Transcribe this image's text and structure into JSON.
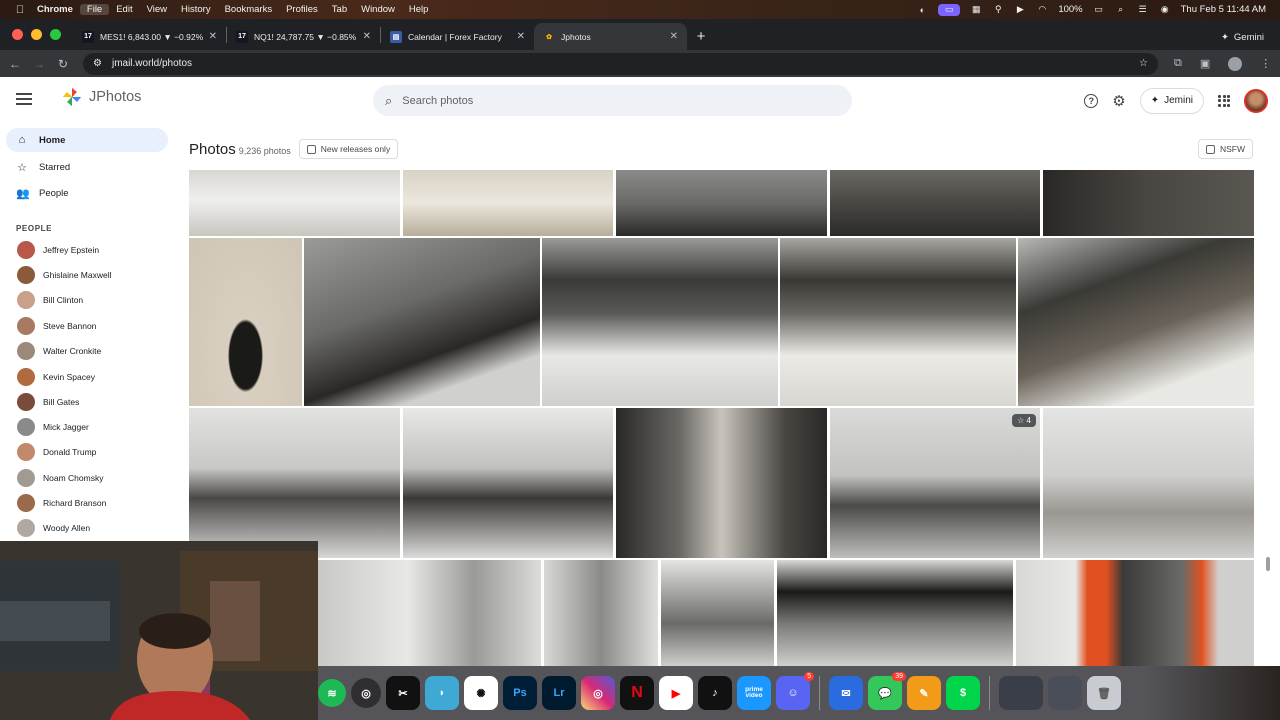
{
  "menubar": {
    "app": "Chrome",
    "items": [
      "File",
      "Edit",
      "View",
      "History",
      "Bookmarks",
      "Profiles",
      "Tab",
      "Window",
      "Help"
    ],
    "battery": "100%",
    "datetime": "Thu Feb 5  11:44 AM"
  },
  "tabs": [
    {
      "title": "MES1! 6,843.00 ▼ −0.92% G",
      "favicon": "tradingview-icon"
    },
    {
      "title": "NQ1! 24,787.75 ▼ −0.85% G",
      "favicon": "tradingview-icon"
    },
    {
      "title": "Calendar | Forex Factory",
      "favicon": "forexfactory-icon"
    },
    {
      "title": "Jphotos",
      "favicon": "jphotos-icon",
      "active": true
    }
  ],
  "gemini_label": "Gemini",
  "url": "jmail.world/photos",
  "app": {
    "name": "JPhotos",
    "search_placeholder": "Search photos",
    "jemini_label": "Jemini"
  },
  "nav": [
    {
      "label": "Home",
      "icon": "home-icon",
      "active": true
    },
    {
      "label": "Starred",
      "icon": "star-icon"
    },
    {
      "label": "People",
      "icon": "people-icon"
    }
  ],
  "people_title": "PEOPLE",
  "people": [
    "Jeffrey Epstein",
    "Ghislaine Maxwell",
    "Bill Clinton",
    "Steve Bannon",
    "Walter Cronkite",
    "Kevin Spacey",
    "Bill Gates",
    "Mick Jagger",
    "Donald Trump",
    "Noam Chomsky",
    "Richard Branson",
    "Woody Allen"
  ],
  "main": {
    "title": "Photos",
    "count": "9,236 photos",
    "new_releases": "New releases only",
    "nsfw": "NSFW",
    "star_count": "☆ 4"
  },
  "dock": [
    {
      "name": "spotify",
      "label": "",
      "color": "#1db954"
    },
    {
      "name": "obs",
      "label": "",
      "color": "#302e31"
    },
    {
      "name": "capcut",
      "label": "",
      "color": "#111111"
    },
    {
      "name": "safari-like",
      "label": "",
      "color": "#3fa9d6"
    },
    {
      "name": "chatgpt",
      "label": "",
      "color": "#ffffff"
    },
    {
      "name": "photoshop",
      "label": "Ps",
      "color": "#001e36"
    },
    {
      "name": "lightroom",
      "label": "Lr",
      "color": "#001a2e"
    },
    {
      "name": "instagram",
      "label": "",
      "color": "#d6249f"
    },
    {
      "name": "netflix",
      "label": "N",
      "color": "#111111"
    },
    {
      "name": "youtube",
      "label": "",
      "color": "#ffffff"
    },
    {
      "name": "tiktok",
      "label": "",
      "color": "#111111"
    },
    {
      "name": "prime-video",
      "label": "prime video",
      "color": "#1a98ff"
    },
    {
      "name": "discord",
      "label": "",
      "color": "#5865f2",
      "badge": "5"
    },
    {
      "name": "mail",
      "label": "",
      "color": "#2b6be0"
    },
    {
      "name": "messages",
      "label": "",
      "color": "#34c759",
      "badge": "39"
    },
    {
      "name": "pages",
      "label": "",
      "color": "#f29b18"
    },
    {
      "name": "cash",
      "label": "",
      "color": "#00d54b"
    }
  ]
}
